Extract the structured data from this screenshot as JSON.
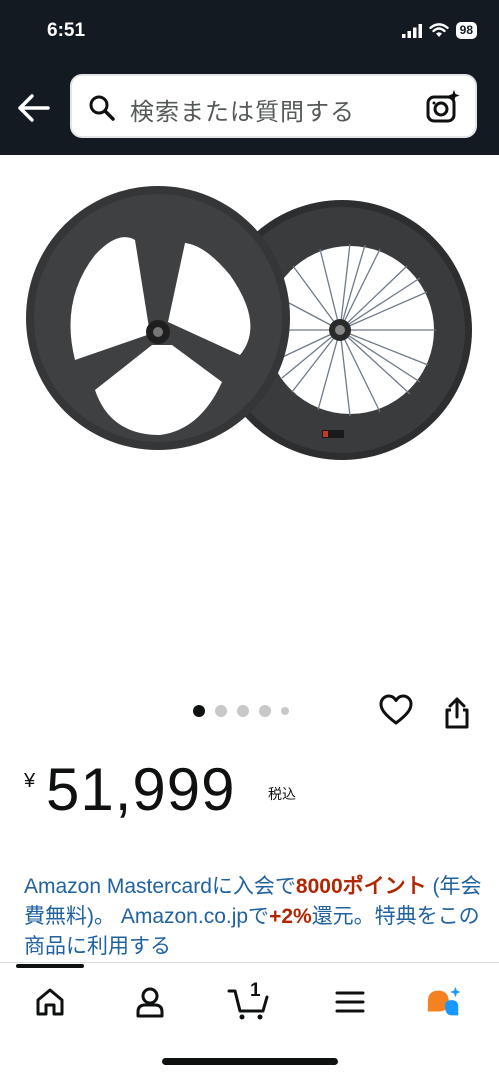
{
  "status_bar": {
    "time": "6:51",
    "battery": "98"
  },
  "search": {
    "placeholder": "検索または質問する"
  },
  "product": {
    "price_symbol": "¥",
    "price": "51,999",
    "tax_label": "税込"
  },
  "carousel": {
    "total_dots": 5,
    "active_index": 0
  },
  "promo": {
    "part1": "Amazon Mastercardに入会で",
    "points": "8000ポイント",
    "part2": " (年会費無料)。 Amazon.co.jpで",
    "bonus": "+2%",
    "part3": "還元。特典をこの商品に利用する"
  },
  "cart": {
    "count": "1"
  },
  "colors": {
    "header_bg": "#131a22",
    "link": "#2162a1",
    "promo_red": "#b12704"
  },
  "bottom_nav": [
    "home-icon",
    "account-icon",
    "cart-icon",
    "menu-icon",
    "rufus-icon"
  ]
}
